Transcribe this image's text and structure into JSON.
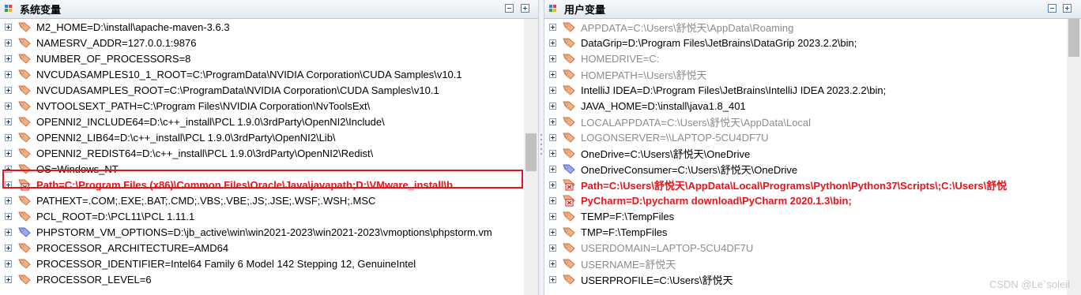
{
  "left_pane": {
    "title": "系统变量",
    "rows": [
      {
        "text": "M2_HOME=D:\\install\\apache-maven-3.6.3",
        "style": "normal",
        "icon": "tag-icon"
      },
      {
        "text": "NAMESRV_ADDR=127.0.0.1:9876",
        "style": "normal",
        "icon": "tag-icon"
      },
      {
        "text": "NUMBER_OF_PROCESSORS=8",
        "style": "normal",
        "icon": "tag-icon"
      },
      {
        "text": "NVCUDASAMPLES10_1_ROOT=C:\\ProgramData\\NVIDIA Corporation\\CUDA Samples\\v10.1",
        "style": "normal",
        "icon": "tag-icon"
      },
      {
        "text": "NVCUDASAMPLES_ROOT=C:\\ProgramData\\NVIDIA Corporation\\CUDA Samples\\v10.1",
        "style": "normal",
        "icon": "tag-icon"
      },
      {
        "text": "NVTOOLSEXT_PATH=C:\\Program Files\\NVIDIA Corporation\\NvToolsExt\\",
        "style": "normal",
        "icon": "tag-icon"
      },
      {
        "text": "OPENNI2_INCLUDE64=D:\\c++_install\\PCL 1.9.0\\3rdParty\\OpenNI2\\Include\\",
        "style": "normal",
        "icon": "tag-icon"
      },
      {
        "text": "OPENNI2_LIB64=D:\\c++_install\\PCL 1.9.0\\3rdParty\\OpenNI2\\Lib\\",
        "style": "normal",
        "icon": "tag-icon"
      },
      {
        "text": "OPENNI2_REDIST64=D:\\c++_install\\PCL 1.9.0\\3rdParty\\OpenNI2\\Redist\\",
        "style": "normal",
        "icon": "tag-icon"
      },
      {
        "text": "OS=Windows_NT",
        "style": "normal",
        "icon": "tag-icon"
      },
      {
        "text": "Path=C:\\Program Files (x86)\\Common Files\\Oracle\\Java\\javapath;D:\\VMware_install\\b",
        "style": "red",
        "icon": "path-error-icon"
      },
      {
        "text": "PATHEXT=.COM;.EXE;.BAT;.CMD;.VBS;.VBE;.JS;.JSE;.WSF;.WSH;.MSC",
        "style": "normal",
        "icon": "tag-icon"
      },
      {
        "text": "PCL_ROOT=D:\\PCL11\\PCL 1.11.1",
        "style": "normal",
        "icon": "tag-icon"
      },
      {
        "text": "PHPSTORM_VM_OPTIONS=D:\\jb_active\\win\\win2021-2023\\win2021-2023\\vmoptions\\phpstorm.vm",
        "style": "normal",
        "icon": "expand-tag-icon"
      },
      {
        "text": "PROCESSOR_ARCHITECTURE=AMD64",
        "style": "normal",
        "icon": "tag-icon"
      },
      {
        "text": "PROCESSOR_IDENTIFIER=Intel64 Family 6 Model 142 Stepping 12, GenuineIntel",
        "style": "normal",
        "icon": "tag-icon"
      },
      {
        "text": "PROCESSOR_LEVEL=6",
        "style": "normal",
        "icon": "tag-icon"
      }
    ]
  },
  "right_pane": {
    "title": "用户变量",
    "rows": [
      {
        "text": "APPDATA=C:\\Users\\舒悦天\\AppData\\Roaming",
        "style": "grey",
        "icon": "tag-icon"
      },
      {
        "text": "DataGrip=D:\\Program Files\\JetBrains\\DataGrip 2023.2.2\\bin;",
        "style": "normal",
        "icon": "tag-icon"
      },
      {
        "text": "HOMEDRIVE=C:",
        "style": "grey",
        "icon": "tag-icon"
      },
      {
        "text": "HOMEPATH=\\Users\\舒悦天",
        "style": "grey",
        "icon": "tag-icon"
      },
      {
        "text": "IntelliJ IDEA=D:\\Program Files\\JetBrains\\IntelliJ IDEA 2023.2.2\\bin;",
        "style": "normal",
        "icon": "tag-icon"
      },
      {
        "text": "JAVA_HOME=D:\\install\\java1.8_401",
        "style": "normal",
        "icon": "tag-icon"
      },
      {
        "text": "LOCALAPPDATA=C:\\Users\\舒悦天\\AppData\\Local",
        "style": "grey",
        "icon": "tag-icon"
      },
      {
        "text": "LOGONSERVER=\\\\LAPTOP-5CU4DF7U",
        "style": "grey",
        "icon": "tag-icon"
      },
      {
        "text": "OneDrive=C:\\Users\\舒悦天\\OneDrive",
        "style": "normal",
        "icon": "tag-icon"
      },
      {
        "text": "OneDriveConsumer=C:\\Users\\舒悦天\\OneDrive",
        "style": "normal",
        "icon": "expand-tag-icon"
      },
      {
        "text": "Path=C:\\Users\\舒悦天\\AppData\\Local\\Programs\\Python\\Python37\\Scripts\\;C:\\Users\\舒悦",
        "style": "red",
        "icon": "path-error-icon"
      },
      {
        "text": "PyCharm=D:\\pycharm download\\PyCharm 2020.1.3\\bin;",
        "style": "red",
        "icon": "path-error-icon"
      },
      {
        "text": "TEMP=F:\\TempFiles",
        "style": "normal",
        "icon": "tag-icon"
      },
      {
        "text": "TMP=F:\\TempFiles",
        "style": "normal",
        "icon": "tag-icon"
      },
      {
        "text": "USERDOMAIN=LAPTOP-5CU4DF7U",
        "style": "grey",
        "icon": "tag-icon"
      },
      {
        "text": "USERNAME=舒悦天",
        "style": "grey",
        "icon": "tag-icon"
      },
      {
        "text": "USERPROFILE=C:\\Users\\舒悦天",
        "style": "normal",
        "icon": "tag-icon"
      }
    ]
  },
  "left_scrollbar": {
    "position": 0.48
  },
  "right_scrollbar": {
    "position": 0.0
  },
  "watermark": "CSDN @Le`soleil",
  "colors": {
    "header_bg": "#e3e9f1",
    "error_text": "#e8141b",
    "grey_text": "#8c8c8c",
    "tag_orange": "#f2a46f",
    "highlight_border": "#e3151b"
  }
}
